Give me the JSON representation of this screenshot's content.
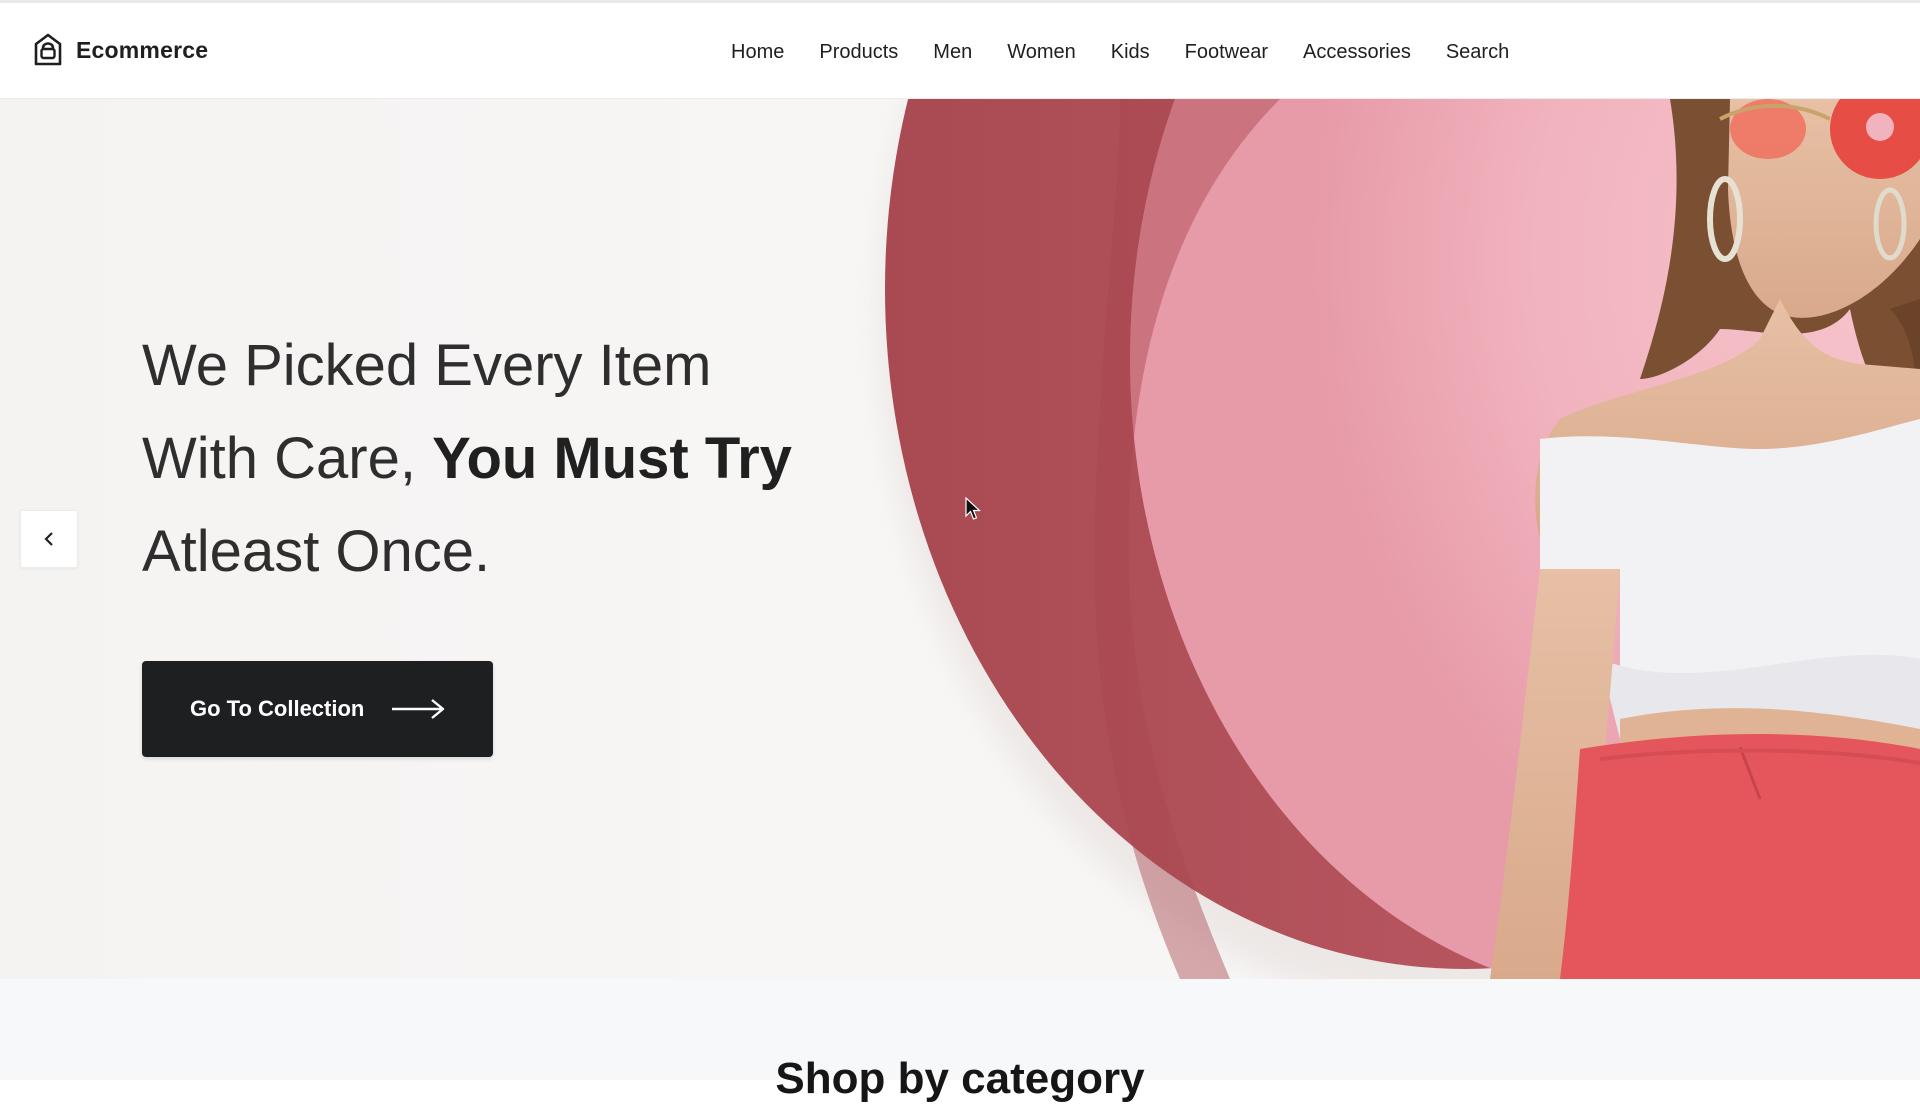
{
  "brand": {
    "name": "Ecommerce",
    "icon": "shopping-bag-icon"
  },
  "nav": {
    "items": [
      "Home",
      "Products",
      "Men",
      "Women",
      "Kids",
      "Footwear",
      "Accessories",
      "Search"
    ]
  },
  "hero": {
    "headline_line1": "We Picked Every Item",
    "headline_line2_regular": "With Care, ",
    "headline_line2_bold": "You Must Try",
    "headline_line3": "Atleast Once.",
    "cta_label": "Go To Collection",
    "cta_icon": "arrow-right-icon",
    "prev_icon": "chevron-left-icon"
  },
  "category": {
    "title": "Shop by category"
  },
  "colors": {
    "accent_dark": "#1e1f21",
    "hero_pink": "#f3b9c3",
    "hero_rose": "#b3515a"
  }
}
